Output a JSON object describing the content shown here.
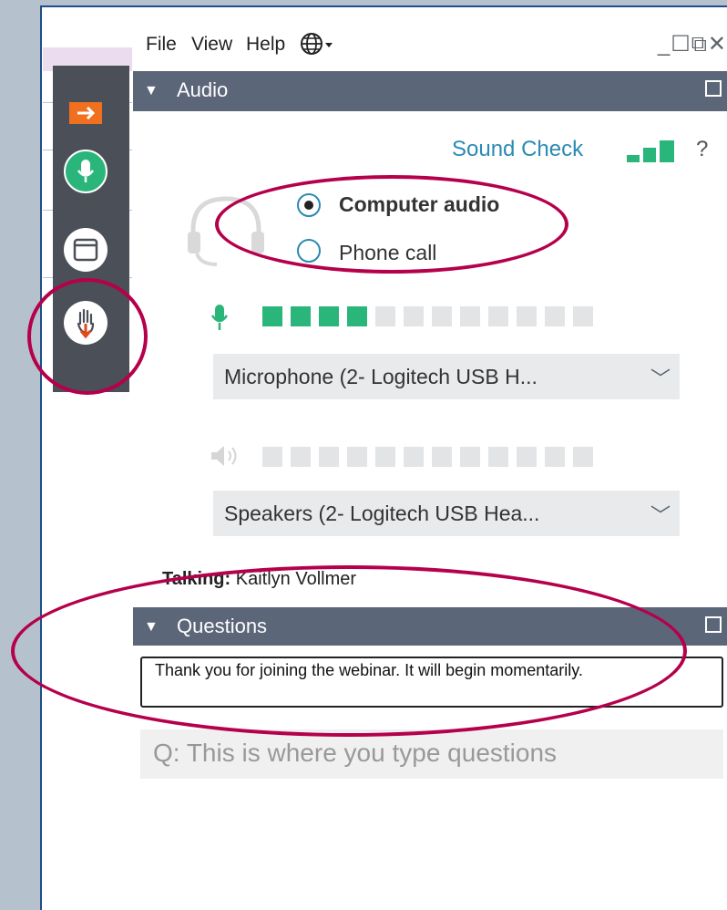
{
  "menu": {
    "file": "File",
    "view": "View",
    "help": "Help"
  },
  "window_buttons": "_☐⧉✕",
  "audio_panel": {
    "title": "Audio",
    "sound_check": "Sound Check",
    "sound_check_help": "?",
    "options": [
      {
        "label": "Computer audio",
        "selected": true
      },
      {
        "label": "Phone call",
        "selected": false
      }
    ],
    "mic_level_bars": 4,
    "meter_total_bars": 12,
    "microphone": "Microphone (2- Logitech USB H...",
    "speaker_level_bars": 0,
    "speakers": "Speakers (2- Logitech USB Hea...",
    "talking_label": "Talking:",
    "talking_name": "Kaitlyn Vollmer"
  },
  "questions_panel": {
    "title": "Questions",
    "message": "Thank you for joining the webinar. It will begin momentarily.",
    "input_placeholder": "Q: This is where you type questions"
  },
  "colors": {
    "accent_green": "#2ab57a",
    "header_bg": "#5c6679",
    "link_blue": "#2a8ab3",
    "highlight_red": "#b5004b",
    "toolbar_bg": "#4b4f57"
  },
  "icons": [
    "arrow-right-icon",
    "microphone-icon",
    "window-icon",
    "raise-hand-icon",
    "globe-icon",
    "headset-icon",
    "speaker-icon",
    "chevron-down-icon"
  ]
}
